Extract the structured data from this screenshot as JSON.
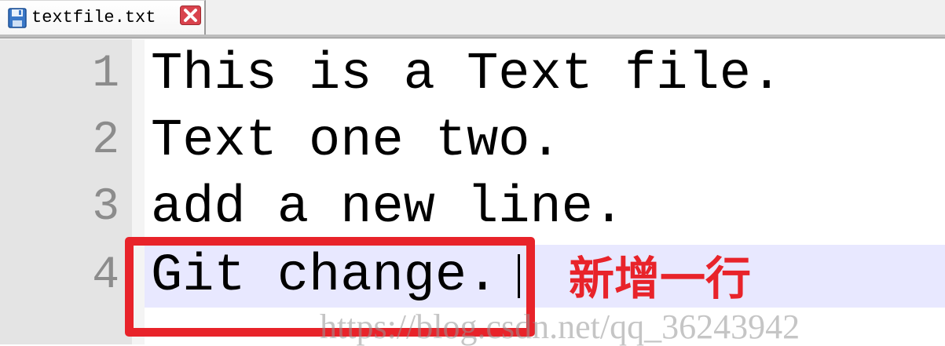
{
  "tab": {
    "filename": "textfile.txt",
    "save_icon": "floppy-disk-icon",
    "close_icon": "close-x-icon"
  },
  "editor": {
    "lines": [
      {
        "number": "1",
        "text": "This is a Text file."
      },
      {
        "number": "2",
        "text": "Text one two."
      },
      {
        "number": "3",
        "text": "add a new line."
      },
      {
        "number": "4",
        "text": "Git change."
      }
    ],
    "current_line": 4
  },
  "annotation": {
    "label": "新增一行",
    "color": "#e8232a"
  },
  "watermark": {
    "text": "https://blog.csdn.net/qq_36243942"
  },
  "colors": {
    "gutter": "#e4e4e4",
    "current_line": "#e8e8ff",
    "line_number": "#8c8c8c",
    "highlight_red": "#e8232a"
  }
}
